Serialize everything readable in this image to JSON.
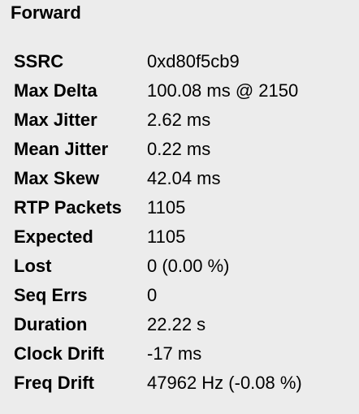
{
  "title": "Forward",
  "rows": [
    {
      "label": "SSRC",
      "value": "0xd80f5cb9"
    },
    {
      "label": "Max Delta",
      "value": "100.08 ms @ 2150"
    },
    {
      "label": "Max Jitter",
      "value": "2.62 ms"
    },
    {
      "label": "Mean Jitter",
      "value": "0.22 ms"
    },
    {
      "label": "Max Skew",
      "value": "42.04 ms"
    },
    {
      "label": "RTP Packets",
      "value": "1105"
    },
    {
      "label": "Expected",
      "value": "1105"
    },
    {
      "label": "Lost",
      "value": "0 (0.00 %)"
    },
    {
      "label": "Seq Errs",
      "value": "0"
    },
    {
      "label": "Duration",
      "value": "22.22 s"
    },
    {
      "label": "Clock Drift",
      "value": "-17 ms"
    },
    {
      "label": "Freq Drift",
      "value": "47962 Hz (-0.08 %)"
    }
  ]
}
